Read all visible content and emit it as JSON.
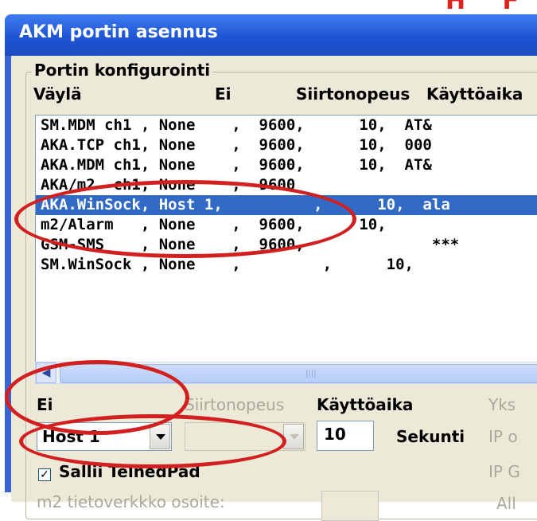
{
  "background": {
    "red_fragment": "H F"
  },
  "window": {
    "title": "AKM portin asennus"
  },
  "group": {
    "legend": "Portin konfigurointi",
    "columns": [
      "Väylä",
      "Ei",
      "Siirtonopeus",
      "Käyttöaika"
    ]
  },
  "list": {
    "rows": [
      "SM.MDM ch1 , None    ,  9600,      10,  AT&",
      "AKA.TCP ch1, None    ,  9600,      10,  000",
      "AKA.MDM ch1, None    ,  9600,      10,  AT&",
      "AKA/m2  ch1, None    ,  9600",
      "AKA.WinSock, Host 1,          ,      10,  ala",
      "m2/Alarm   , None    ,  9600,      10,",
      "GSM-SMS    , None    ,  9600,              ***",
      "SM.WinSock , None    ,         ,      10,",
      ""
    ],
    "selected_index": 4
  },
  "form": {
    "ei_label": "Ei",
    "ei_value": "Host 1",
    "siirtonopeus_label": "Siirtonopeus",
    "kayttoaika_label": "Käyttöaika",
    "kayttoaika_value": "10",
    "sekunti_label": "Sekunti",
    "yks_label": "Yks",
    "ip_o_label": "IP o",
    "ip_g_label": "IP G",
    "checkbox_label": "Sallii TelnedPad",
    "checkbox_mark": "✓",
    "m2_label": "m2 tietoverkkko osoite:",
    "all_label": "All"
  },
  "colors": {
    "annotation": "#d21f1f",
    "selection": "#316ac5"
  }
}
